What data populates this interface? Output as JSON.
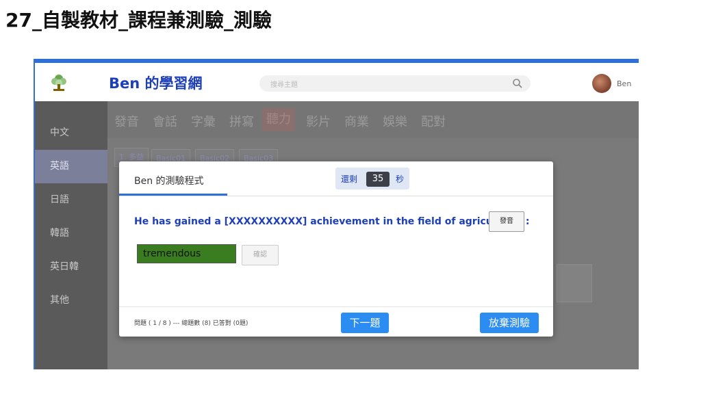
{
  "slide": {
    "title": "27_自製教材_課程兼測驗_測驗"
  },
  "header": {
    "brand": "Ben 的學習網",
    "search_placeholder": "搜尋主題",
    "user_name": "Ben",
    "logo_icon": "tree-logo-icon",
    "search_icon": "search-icon"
  },
  "sidebar": {
    "items": [
      {
        "label": "中文"
      },
      {
        "label": "英語"
      },
      {
        "label": "日語"
      },
      {
        "label": "韓語"
      },
      {
        "label": "英日韓"
      },
      {
        "label": "其他"
      }
    ],
    "active_index": 1
  },
  "categories": {
    "items": [
      "發音",
      "會話",
      "字彙",
      "拼寫",
      "聽力",
      "影片",
      "商業",
      "娛樂",
      "配對"
    ],
    "active_index": 4
  },
  "lessons": {
    "group_label": "1. 多益",
    "items": [
      "Basic01",
      "Basic02",
      "Basic03"
    ]
  },
  "modal": {
    "tab_label": "Ben 的測驗程式",
    "timer_prefix": "還剩",
    "timer_value": "35",
    "timer_suffix": "秒",
    "question": "He has gained a [XXXXXXXXXX] achievement in the field of agriculture. :",
    "speak_label": "發音",
    "answer_value": "tremendous",
    "confirm_label": "確認",
    "status": "問題 ( 1 / 8 ) --- 總題數 (8) 已答對 (0題)",
    "next_label": "下一題",
    "quit_label": "放棄測驗"
  },
  "colors": {
    "accent": "#2f6fd6",
    "brand_text": "#1d3fb8",
    "button_blue": "#2b8cf2",
    "answer_green": "#3a7d20"
  }
}
